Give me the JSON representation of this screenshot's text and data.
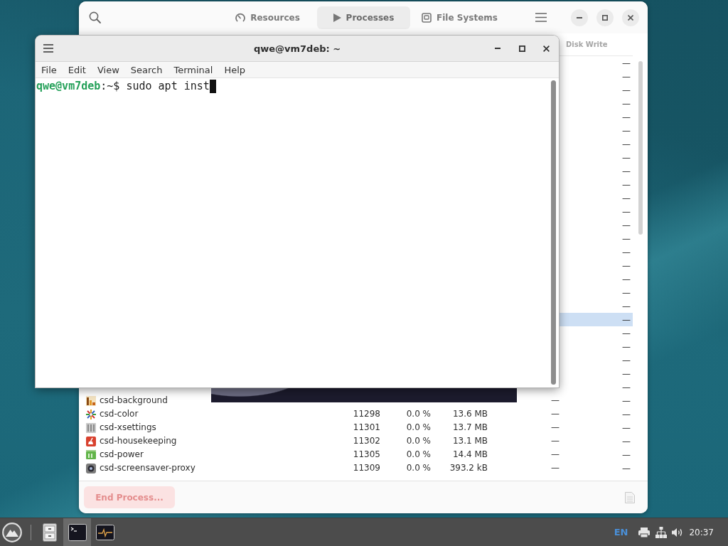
{
  "system_monitor": {
    "tabs": [
      {
        "kind": "resources",
        "label": "Resources",
        "selected": false
      },
      {
        "kind": "processes",
        "label": "Processes",
        "selected": true
      },
      {
        "kind": "filesystems",
        "label": "File Systems",
        "selected": false
      }
    ],
    "columns": {
      "disk_write": "Disk Write"
    },
    "rows": [
      {
        "disk_write": "—",
        "selected": false
      },
      {
        "disk_write": "—",
        "selected": false
      },
      {
        "disk_write": "—",
        "selected": false
      },
      {
        "disk_write": "—",
        "selected": false
      },
      {
        "disk_write": "—",
        "selected": false
      },
      {
        "disk_write": "—",
        "selected": false
      },
      {
        "disk_write": "—",
        "selected": false
      },
      {
        "disk_write": "—",
        "selected": false
      },
      {
        "disk_write": "—",
        "selected": false
      },
      {
        "disk_write": "—",
        "selected": false
      },
      {
        "disk_write": "—",
        "selected": false
      },
      {
        "disk_write": "—",
        "selected": false
      },
      {
        "disk_write": "—",
        "selected": false
      },
      {
        "disk_write": "—",
        "selected": false
      },
      {
        "disk_write": "—",
        "selected": false
      },
      {
        "disk_write": "—",
        "selected": false
      },
      {
        "disk_write": "—",
        "selected": false
      },
      {
        "disk_write": "—",
        "selected": false
      },
      {
        "disk_write": "—",
        "selected": false
      },
      {
        "disk_write": "—",
        "selected": true
      },
      {
        "disk_write": "—",
        "selected": false
      },
      {
        "disk_write": "—",
        "selected": false
      },
      {
        "disk_write": "—",
        "selected": false
      },
      {
        "disk_write": "—",
        "selected": false
      },
      {
        "disk_write": "—",
        "selected": false
      },
      {
        "kind": "chart",
        "name": "csd-background",
        "disk_read": "—",
        "disk_write": "—",
        "selected": false
      },
      {
        "kind": "color",
        "name": "csd-color",
        "pid": "11298",
        "cpu": "0.0 %",
        "memory": "13.6 MB",
        "disk_read": "—",
        "disk_write": "—",
        "selected": false
      },
      {
        "kind": "settings",
        "name": "csd-xsettings",
        "pid": "11301",
        "cpu": "0.0 %",
        "memory": "13.7 MB",
        "disk_read": "—",
        "disk_write": "—",
        "selected": false
      },
      {
        "kind": "housekeeping",
        "name": "csd-housekeeping",
        "pid": "11302",
        "cpu": "0.0 %",
        "memory": "13.1 MB",
        "disk_read": "—",
        "disk_write": "—",
        "selected": false
      },
      {
        "kind": "power",
        "name": "csd-power",
        "pid": "11305",
        "cpu": "0.0 %",
        "memory": "14.4 MB",
        "disk_read": "—",
        "disk_write": "—",
        "selected": false
      },
      {
        "kind": "screensaver",
        "name": "csd-screensaver-proxy",
        "pid": "11309",
        "cpu": "0.0 %",
        "memory": "393.2 kB",
        "disk_read": "—",
        "disk_write": "—",
        "selected": false
      }
    ],
    "end_process_button": {
      "label": "End Process...",
      "disabled": true
    },
    "properties_button": {
      "disabled": true
    }
  },
  "terminal": {
    "title": "qwe@vm7deb: ~",
    "menu": [
      "File",
      "Edit",
      "View",
      "Search",
      "Terminal",
      "Help"
    ],
    "prompt_user": "qwe@vm7deb",
    "prompt_rest": ":~$",
    "command": "sudo apt inst"
  },
  "taskbar": {
    "apps": [
      {
        "kind": "files",
        "selected": false
      },
      {
        "kind": "terminal",
        "selected": true
      },
      {
        "kind": "monitor",
        "selected": false
      }
    ],
    "keyboard_layout": "EN",
    "clock": "20:37"
  }
}
